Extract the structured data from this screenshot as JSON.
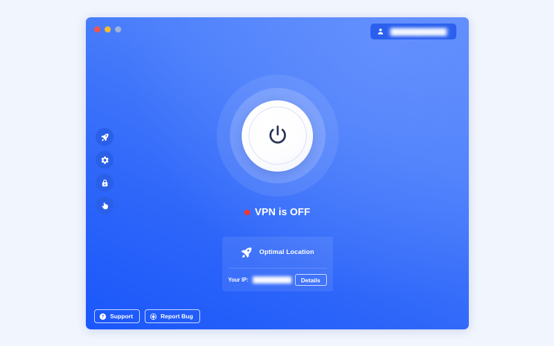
{
  "window": {
    "traffic_lights": [
      {
        "name": "close",
        "color": "#f4534a"
      },
      {
        "name": "minimize",
        "color": "#f6bc2e"
      },
      {
        "name": "zoom",
        "color": "#9fb4d6"
      }
    ],
    "background_top": "#5b8bfc",
    "background_bottom": "#1a57fb"
  },
  "account": {
    "icon": "person-icon",
    "name": "████████████",
    "redacted": true
  },
  "sidebar": {
    "items": [
      {
        "icon": "rocket-icon",
        "label": "Quick Connect"
      },
      {
        "icon": "gear-icon",
        "label": "Settings"
      },
      {
        "icon": "lock-icon",
        "label": "Security"
      },
      {
        "icon": "hand-icon",
        "label": "Block"
      }
    ]
  },
  "power": {
    "icon": "power-icon",
    "state": "off"
  },
  "status": {
    "text": "VPN is OFF",
    "dot_color": "#f5342b"
  },
  "location": {
    "icon": "rocket-icon",
    "label": "Optimal Location",
    "ip_label": "Your IP:",
    "ip_value": "█████████████",
    "ip_redacted": true,
    "details_label": "Details"
  },
  "footer": {
    "buttons": [
      {
        "icon": "question-icon",
        "label": "Support"
      },
      {
        "icon": "bug-icon",
        "label": "Report Bug"
      }
    ]
  }
}
